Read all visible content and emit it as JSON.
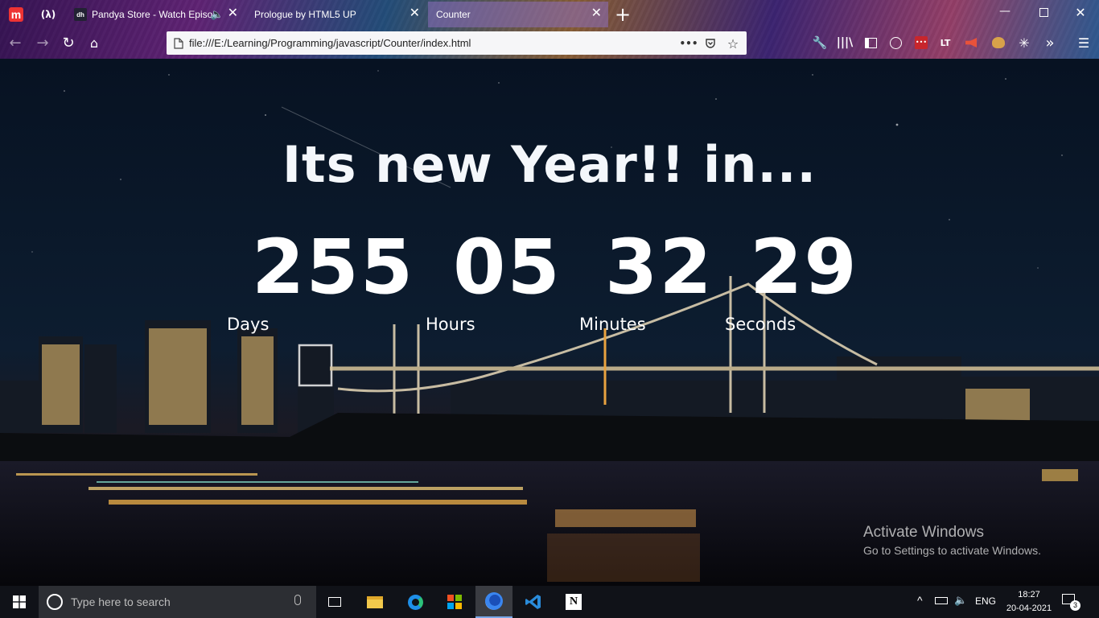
{
  "browser": {
    "tabs": [
      {
        "label": "",
        "favicon": "m-icon",
        "pinned": true
      },
      {
        "label": "",
        "favicon": "lambda-icon",
        "pinned": true
      },
      {
        "label": "Pandya Store - Watch Episo",
        "favicon": "dh-icon",
        "audio": true
      },
      {
        "label": "Prologue by HTML5 UP",
        "favicon": "none"
      },
      {
        "label": "Counter",
        "favicon": "none",
        "active": true
      }
    ],
    "new_tab_label": "+",
    "url": "file:///E:/Learning/Programming/javascript/Counter/index.html",
    "url_menu_label": "•••"
  },
  "page": {
    "headline": "Its new Year!! in...",
    "countdown": [
      {
        "value": "255",
        "label": "Days"
      },
      {
        "value": "05",
        "label": "Hours"
      },
      {
        "value": "32",
        "label": "Minutes"
      },
      {
        "value": "29",
        "label": "Seconds"
      }
    ],
    "watermark": {
      "title": "Activate Windows",
      "subtitle": "Go to Settings to activate Windows."
    }
  },
  "taskbar": {
    "search_placeholder": "Type here to search",
    "apps": [
      "task-view-icon",
      "file-explorer-icon",
      "edge-icon",
      "store-icon",
      "firefox-icon",
      "vscode-icon",
      "notion-icon"
    ],
    "language": "ENG",
    "time": "18:27",
    "date": "20-04-2021",
    "notification_count": "3"
  },
  "colors": {
    "accent": "#79a7e8",
    "text": "#ffffff",
    "taskbar": "#101218"
  }
}
